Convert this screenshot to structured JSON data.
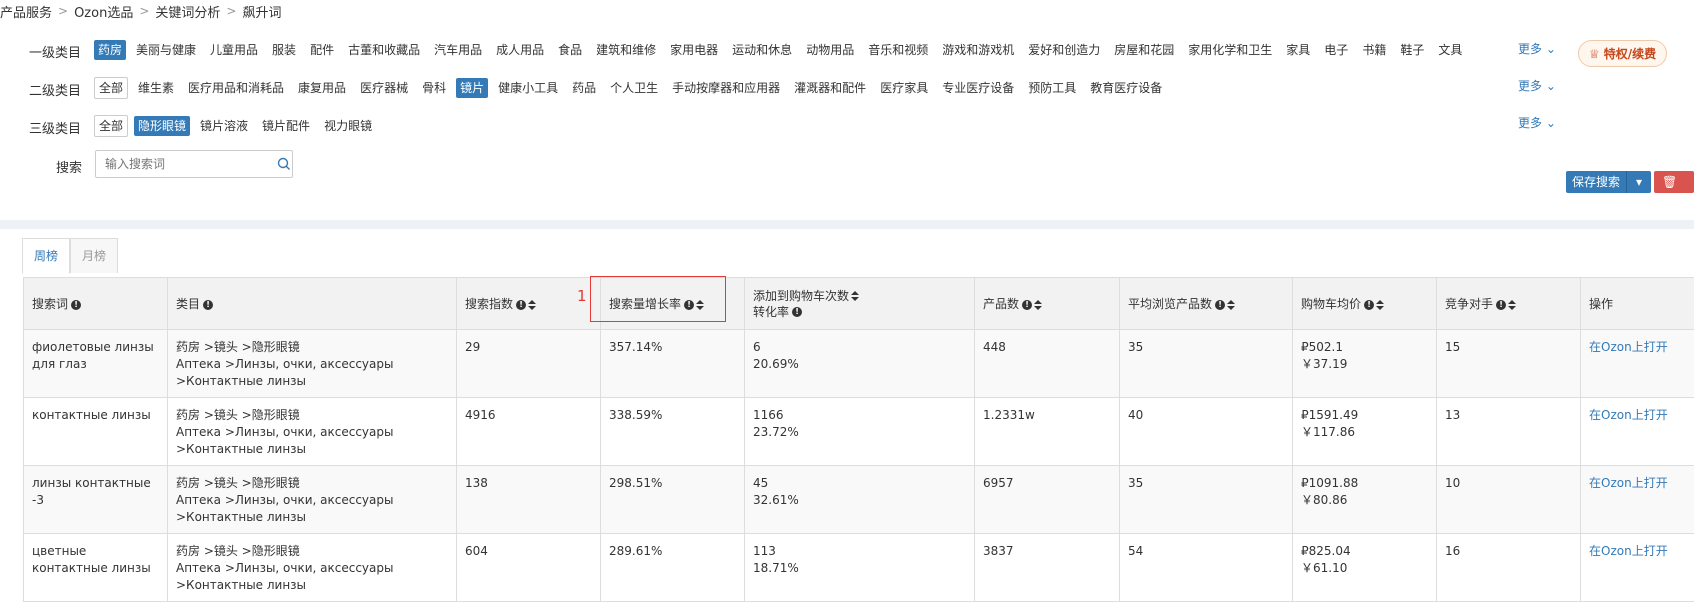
{
  "breadcrumb": [
    "产品服务",
    "Ozon选品",
    "关键词分析",
    "飙升词"
  ],
  "filters": {
    "level1_label": "一级类目",
    "level1_items": [
      "药房",
      "美丽与健康",
      "儿童用品",
      "服装",
      "配件",
      "古董和收藏品",
      "汽车用品",
      "成人用品",
      "食品",
      "建筑和维修",
      "家用电器",
      "运动和休息",
      "动物用品",
      "音乐和视频",
      "游戏和游戏机",
      "爱好和创造力",
      "房屋和花园",
      "家用化学和卫生",
      "家具",
      "电子",
      "书籍",
      "鞋子",
      "文具"
    ],
    "level2_label": "二级类目",
    "level2_items": [
      "全部",
      "维生素",
      "医疗用品和消耗品",
      "康复用品",
      "医疗器械",
      "骨科",
      "镜片",
      "健康小工具",
      "药品",
      "个人卫生",
      "手动按摩器和应用器",
      "灌溉器和配件",
      "医疗家具",
      "专业医疗设备",
      "预防工具",
      "教育医疗设备"
    ],
    "level3_label": "三级类目",
    "level3_items": [
      "全部",
      "隐形眼镜",
      "镜片溶液",
      "镜片配件",
      "视力眼镜"
    ],
    "more_label": "更多",
    "search_label": "搜索",
    "search_placeholder": "输入搜索词",
    "vip_label": "特权/续费",
    "save_search_label": "保存搜索",
    "clear_label": "清空"
  },
  "tabs": [
    "周榜",
    "月榜"
  ],
  "table": {
    "headers": [
      "搜索词",
      "类目",
      "搜索指数",
      "搜索量增长率",
      "添加到购物车次数",
      "转化率",
      "产品数",
      "平均浏览产品数",
      "购物车均价",
      "竞争对手",
      "操作"
    ],
    "rows": [
      {
        "keyword": "фиолетовые линзы для глаз",
        "cat1": "药房 >镜头 >隐形眼镜",
        "cat2": "Аптека >Линзы, очки, аксессуары >Контактные линзы",
        "index": "29",
        "growth": "357.14%",
        "cart": "6",
        "conv": "20.69%",
        "products": "448",
        "avg_view": "35",
        "price_rub": "₽502.1",
        "price_cny": "￥37.19",
        "competitors": "15",
        "action": "在Ozon上打开"
      },
      {
        "keyword": "контактные линзы",
        "cat1": "药房 >镜头 >隐形眼镜",
        "cat2": "Аптека >Линзы, очки, аксессуары >Контактные линзы",
        "index": "4916",
        "growth": "338.59%",
        "cart": "1166",
        "conv": "23.72%",
        "products": "1.2331w",
        "avg_view": "40",
        "price_rub": "₽1591.49",
        "price_cny": "￥117.86",
        "competitors": "13",
        "action": "在Ozon上打开"
      },
      {
        "keyword": "линзы контактные -3",
        "cat1": "药房 >镜头 >隐形眼镜",
        "cat2": "Аптека >Линзы, очки, аксессуары >Контактные линзы",
        "index": "138",
        "growth": "298.51%",
        "cart": "45",
        "conv": "32.61%",
        "products": "6957",
        "avg_view": "35",
        "price_rub": "₽1091.88",
        "price_cny": "￥80.86",
        "competitors": "10",
        "action": "在Ozon上打开"
      },
      {
        "keyword": "цветные контактные линзы",
        "cat1": "药房 >镜头 >隐形眼镜",
        "cat2": "Аптека >Линзы, очки, аксессуары >Контактные линзы",
        "index": "604",
        "growth": "289.61%",
        "cart": "113",
        "conv": "18.71%",
        "products": "3837",
        "avg_view": "54",
        "price_rub": "₽825.04",
        "price_cny": "￥61.10",
        "competitors": "16",
        "action": "在Ozon上打开"
      }
    ]
  },
  "annotation_number": "1"
}
